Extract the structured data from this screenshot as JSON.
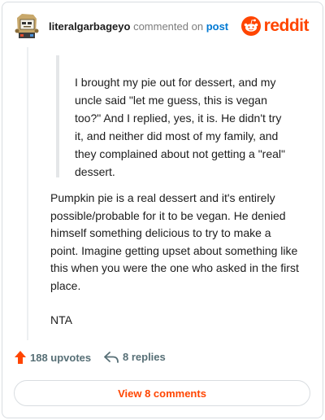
{
  "header": {
    "username": "literalgarbageyo",
    "action_text": "commented on",
    "target_link": "post",
    "brand": "reddit"
  },
  "quote": {
    "lines": [
      "I brought my pie out for dessert, and my",
      "uncle said \"let me guess, this is vegan",
      "too?\" And I replied, yes, it is. He didn't try",
      "it, and neither did most of my family, and",
      "they complained about not getting a \"real\"",
      "dessert."
    ]
  },
  "comment": {
    "paragraph1_lines": [
      "Pumpkin pie is a real dessert and it's entirely",
      "possible/probable for it to be vegan. He denied",
      "himself something delicious to try to make a",
      "point. Imagine getting upset about something like",
      "this when you were the one who asked in the first",
      "place."
    ],
    "paragraph2": "NTA"
  },
  "actions": {
    "upvotes": "188 upvotes",
    "replies": "8 replies"
  },
  "footer": {
    "view_comments": "View 8 comments"
  },
  "colors": {
    "brand_orange": "#ff4500",
    "link_blue": "#0079d3",
    "muted": "#576f76"
  }
}
